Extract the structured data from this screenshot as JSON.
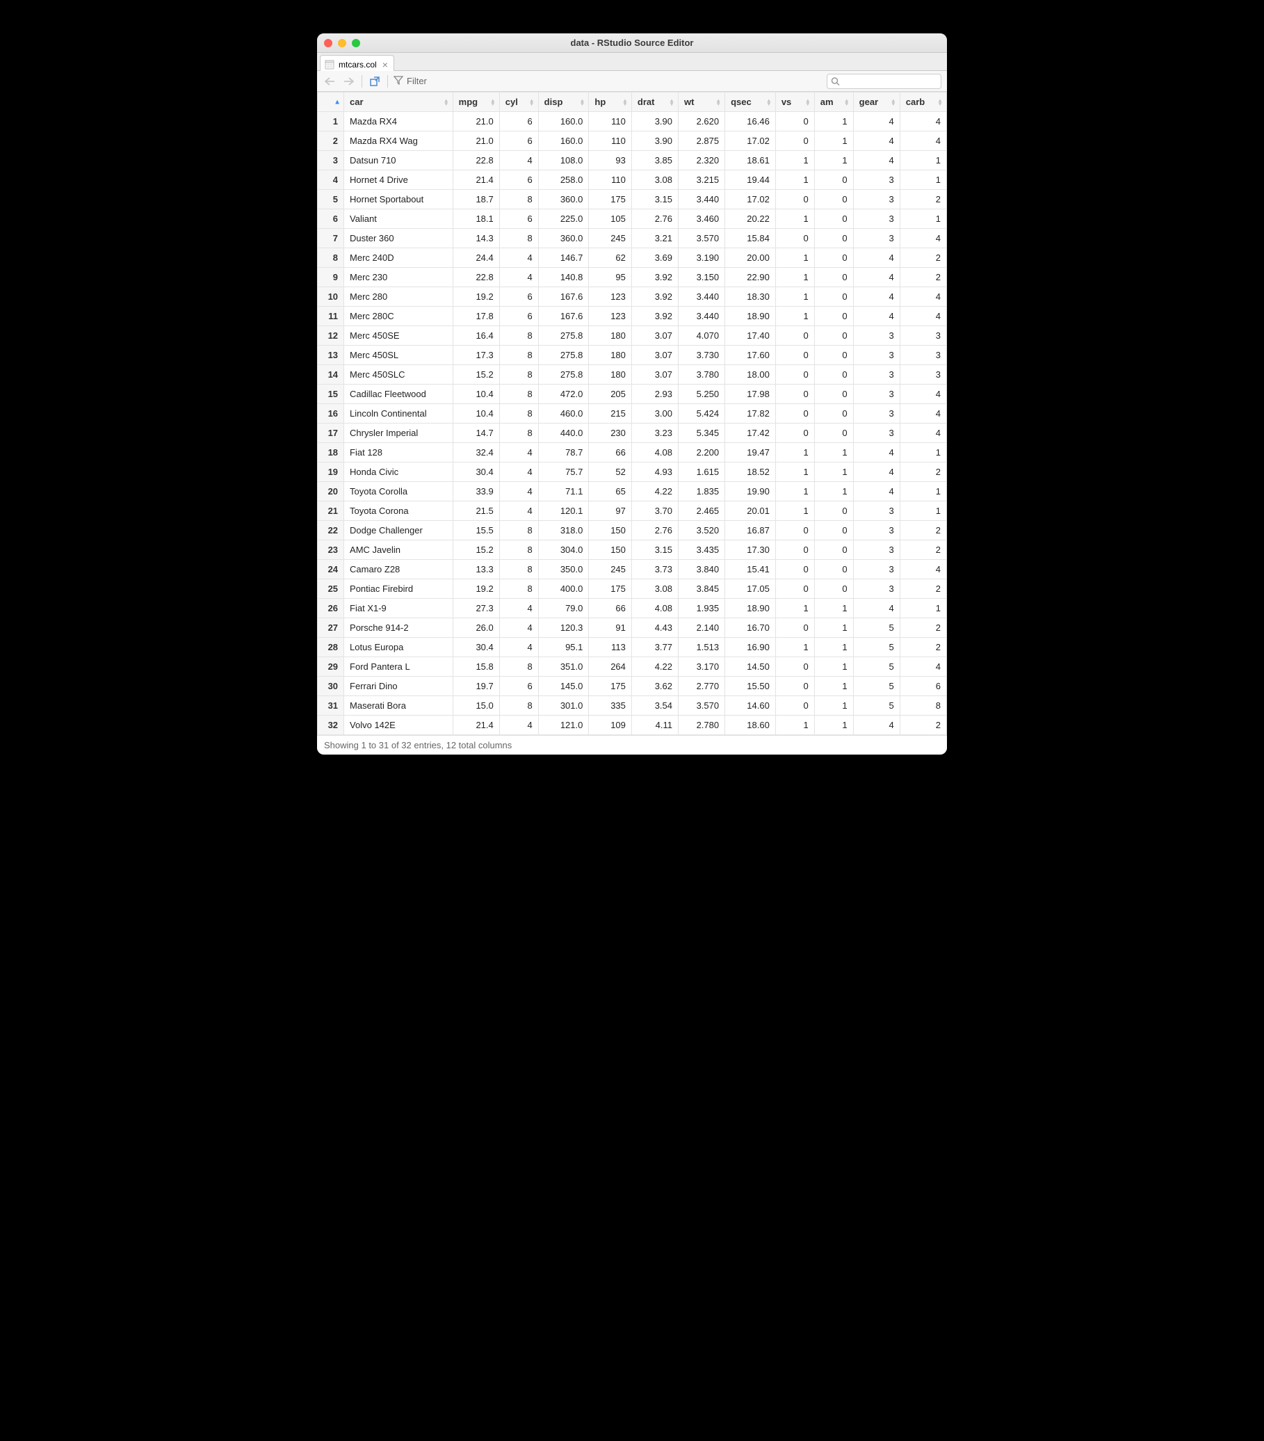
{
  "window_title": "data - RStudio Source Editor",
  "tab": {
    "label": "mtcars.col"
  },
  "toolbar": {
    "filter_label": "Filter",
    "search_placeholder": ""
  },
  "columns": [
    "car",
    "mpg",
    "cyl",
    "disp",
    "hp",
    "drat",
    "wt",
    "qsec",
    "vs",
    "am",
    "gear",
    "carb"
  ],
  "rows": [
    {
      "n": 1,
      "car": "Mazda RX4",
      "mpg": "21.0",
      "cyl": "6",
      "disp": "160.0",
      "hp": "110",
      "drat": "3.90",
      "wt": "2.620",
      "qsec": "16.46",
      "vs": "0",
      "am": "1",
      "gear": "4",
      "carb": "4"
    },
    {
      "n": 2,
      "car": "Mazda RX4 Wag",
      "mpg": "21.0",
      "cyl": "6",
      "disp": "160.0",
      "hp": "110",
      "drat": "3.90",
      "wt": "2.875",
      "qsec": "17.02",
      "vs": "0",
      "am": "1",
      "gear": "4",
      "carb": "4"
    },
    {
      "n": 3,
      "car": "Datsun 710",
      "mpg": "22.8",
      "cyl": "4",
      "disp": "108.0",
      "hp": "93",
      "drat": "3.85",
      "wt": "2.320",
      "qsec": "18.61",
      "vs": "1",
      "am": "1",
      "gear": "4",
      "carb": "1"
    },
    {
      "n": 4,
      "car": "Hornet 4 Drive",
      "mpg": "21.4",
      "cyl": "6",
      "disp": "258.0",
      "hp": "110",
      "drat": "3.08",
      "wt": "3.215",
      "qsec": "19.44",
      "vs": "1",
      "am": "0",
      "gear": "3",
      "carb": "1"
    },
    {
      "n": 5,
      "car": "Hornet Sportabout",
      "mpg": "18.7",
      "cyl": "8",
      "disp": "360.0",
      "hp": "175",
      "drat": "3.15",
      "wt": "3.440",
      "qsec": "17.02",
      "vs": "0",
      "am": "0",
      "gear": "3",
      "carb": "2"
    },
    {
      "n": 6,
      "car": "Valiant",
      "mpg": "18.1",
      "cyl": "6",
      "disp": "225.0",
      "hp": "105",
      "drat": "2.76",
      "wt": "3.460",
      "qsec": "20.22",
      "vs": "1",
      "am": "0",
      "gear": "3",
      "carb": "1"
    },
    {
      "n": 7,
      "car": "Duster 360",
      "mpg": "14.3",
      "cyl": "8",
      "disp": "360.0",
      "hp": "245",
      "drat": "3.21",
      "wt": "3.570",
      "qsec": "15.84",
      "vs": "0",
      "am": "0",
      "gear": "3",
      "carb": "4"
    },
    {
      "n": 8,
      "car": "Merc 240D",
      "mpg": "24.4",
      "cyl": "4",
      "disp": "146.7",
      "hp": "62",
      "drat": "3.69",
      "wt": "3.190",
      "qsec": "20.00",
      "vs": "1",
      "am": "0",
      "gear": "4",
      "carb": "2"
    },
    {
      "n": 9,
      "car": "Merc 230",
      "mpg": "22.8",
      "cyl": "4",
      "disp": "140.8",
      "hp": "95",
      "drat": "3.92",
      "wt": "3.150",
      "qsec": "22.90",
      "vs": "1",
      "am": "0",
      "gear": "4",
      "carb": "2"
    },
    {
      "n": 10,
      "car": "Merc 280",
      "mpg": "19.2",
      "cyl": "6",
      "disp": "167.6",
      "hp": "123",
      "drat": "3.92",
      "wt": "3.440",
      "qsec": "18.30",
      "vs": "1",
      "am": "0",
      "gear": "4",
      "carb": "4"
    },
    {
      "n": 11,
      "car": "Merc 280C",
      "mpg": "17.8",
      "cyl": "6",
      "disp": "167.6",
      "hp": "123",
      "drat": "3.92",
      "wt": "3.440",
      "qsec": "18.90",
      "vs": "1",
      "am": "0",
      "gear": "4",
      "carb": "4"
    },
    {
      "n": 12,
      "car": "Merc 450SE",
      "mpg": "16.4",
      "cyl": "8",
      "disp": "275.8",
      "hp": "180",
      "drat": "3.07",
      "wt": "4.070",
      "qsec": "17.40",
      "vs": "0",
      "am": "0",
      "gear": "3",
      "carb": "3"
    },
    {
      "n": 13,
      "car": "Merc 450SL",
      "mpg": "17.3",
      "cyl": "8",
      "disp": "275.8",
      "hp": "180",
      "drat": "3.07",
      "wt": "3.730",
      "qsec": "17.60",
      "vs": "0",
      "am": "0",
      "gear": "3",
      "carb": "3"
    },
    {
      "n": 14,
      "car": "Merc 450SLC",
      "mpg": "15.2",
      "cyl": "8",
      "disp": "275.8",
      "hp": "180",
      "drat": "3.07",
      "wt": "3.780",
      "qsec": "18.00",
      "vs": "0",
      "am": "0",
      "gear": "3",
      "carb": "3"
    },
    {
      "n": 15,
      "car": "Cadillac Fleetwood",
      "mpg": "10.4",
      "cyl": "8",
      "disp": "472.0",
      "hp": "205",
      "drat": "2.93",
      "wt": "5.250",
      "qsec": "17.98",
      "vs": "0",
      "am": "0",
      "gear": "3",
      "carb": "4"
    },
    {
      "n": 16,
      "car": "Lincoln Continental",
      "mpg": "10.4",
      "cyl": "8",
      "disp": "460.0",
      "hp": "215",
      "drat": "3.00",
      "wt": "5.424",
      "qsec": "17.82",
      "vs": "0",
      "am": "0",
      "gear": "3",
      "carb": "4"
    },
    {
      "n": 17,
      "car": "Chrysler Imperial",
      "mpg": "14.7",
      "cyl": "8",
      "disp": "440.0",
      "hp": "230",
      "drat": "3.23",
      "wt": "5.345",
      "qsec": "17.42",
      "vs": "0",
      "am": "0",
      "gear": "3",
      "carb": "4"
    },
    {
      "n": 18,
      "car": "Fiat 128",
      "mpg": "32.4",
      "cyl": "4",
      "disp": "78.7",
      "hp": "66",
      "drat": "4.08",
      "wt": "2.200",
      "qsec": "19.47",
      "vs": "1",
      "am": "1",
      "gear": "4",
      "carb": "1"
    },
    {
      "n": 19,
      "car": "Honda Civic",
      "mpg": "30.4",
      "cyl": "4",
      "disp": "75.7",
      "hp": "52",
      "drat": "4.93",
      "wt": "1.615",
      "qsec": "18.52",
      "vs": "1",
      "am": "1",
      "gear": "4",
      "carb": "2"
    },
    {
      "n": 20,
      "car": "Toyota Corolla",
      "mpg": "33.9",
      "cyl": "4",
      "disp": "71.1",
      "hp": "65",
      "drat": "4.22",
      "wt": "1.835",
      "qsec": "19.90",
      "vs": "1",
      "am": "1",
      "gear": "4",
      "carb": "1"
    },
    {
      "n": 21,
      "car": "Toyota Corona",
      "mpg": "21.5",
      "cyl": "4",
      "disp": "120.1",
      "hp": "97",
      "drat": "3.70",
      "wt": "2.465",
      "qsec": "20.01",
      "vs": "1",
      "am": "0",
      "gear": "3",
      "carb": "1"
    },
    {
      "n": 22,
      "car": "Dodge Challenger",
      "mpg": "15.5",
      "cyl": "8",
      "disp": "318.0",
      "hp": "150",
      "drat": "2.76",
      "wt": "3.520",
      "qsec": "16.87",
      "vs": "0",
      "am": "0",
      "gear": "3",
      "carb": "2"
    },
    {
      "n": 23,
      "car": "AMC Javelin",
      "mpg": "15.2",
      "cyl": "8",
      "disp": "304.0",
      "hp": "150",
      "drat": "3.15",
      "wt": "3.435",
      "qsec": "17.30",
      "vs": "0",
      "am": "0",
      "gear": "3",
      "carb": "2"
    },
    {
      "n": 24,
      "car": "Camaro Z28",
      "mpg": "13.3",
      "cyl": "8",
      "disp": "350.0",
      "hp": "245",
      "drat": "3.73",
      "wt": "3.840",
      "qsec": "15.41",
      "vs": "0",
      "am": "0",
      "gear": "3",
      "carb": "4"
    },
    {
      "n": 25,
      "car": "Pontiac Firebird",
      "mpg": "19.2",
      "cyl": "8",
      "disp": "400.0",
      "hp": "175",
      "drat": "3.08",
      "wt": "3.845",
      "qsec": "17.05",
      "vs": "0",
      "am": "0",
      "gear": "3",
      "carb": "2"
    },
    {
      "n": 26,
      "car": "Fiat X1-9",
      "mpg": "27.3",
      "cyl": "4",
      "disp": "79.0",
      "hp": "66",
      "drat": "4.08",
      "wt": "1.935",
      "qsec": "18.90",
      "vs": "1",
      "am": "1",
      "gear": "4",
      "carb": "1"
    },
    {
      "n": 27,
      "car": "Porsche 914-2",
      "mpg": "26.0",
      "cyl": "4",
      "disp": "120.3",
      "hp": "91",
      "drat": "4.43",
      "wt": "2.140",
      "qsec": "16.70",
      "vs": "0",
      "am": "1",
      "gear": "5",
      "carb": "2"
    },
    {
      "n": 28,
      "car": "Lotus Europa",
      "mpg": "30.4",
      "cyl": "4",
      "disp": "95.1",
      "hp": "113",
      "drat": "3.77",
      "wt": "1.513",
      "qsec": "16.90",
      "vs": "1",
      "am": "1",
      "gear": "5",
      "carb": "2"
    },
    {
      "n": 29,
      "car": "Ford Pantera L",
      "mpg": "15.8",
      "cyl": "8",
      "disp": "351.0",
      "hp": "264",
      "drat": "4.22",
      "wt": "3.170",
      "qsec": "14.50",
      "vs": "0",
      "am": "1",
      "gear": "5",
      "carb": "4"
    },
    {
      "n": 30,
      "car": "Ferrari Dino",
      "mpg": "19.7",
      "cyl": "6",
      "disp": "145.0",
      "hp": "175",
      "drat": "3.62",
      "wt": "2.770",
      "qsec": "15.50",
      "vs": "0",
      "am": "1",
      "gear": "5",
      "carb": "6"
    },
    {
      "n": 31,
      "car": "Maserati Bora",
      "mpg": "15.0",
      "cyl": "8",
      "disp": "301.0",
      "hp": "335",
      "drat": "3.54",
      "wt": "3.570",
      "qsec": "14.60",
      "vs": "0",
      "am": "1",
      "gear": "5",
      "carb": "8"
    },
    {
      "n": 32,
      "car": "Volvo 142E",
      "mpg": "21.4",
      "cyl": "4",
      "disp": "121.0",
      "hp": "109",
      "drat": "4.11",
      "wt": "2.780",
      "qsec": "18.60",
      "vs": "1",
      "am": "1",
      "gear": "4",
      "carb": "2"
    }
  ],
  "status": "Showing 1 to 31 of 32 entries, 12 total columns"
}
